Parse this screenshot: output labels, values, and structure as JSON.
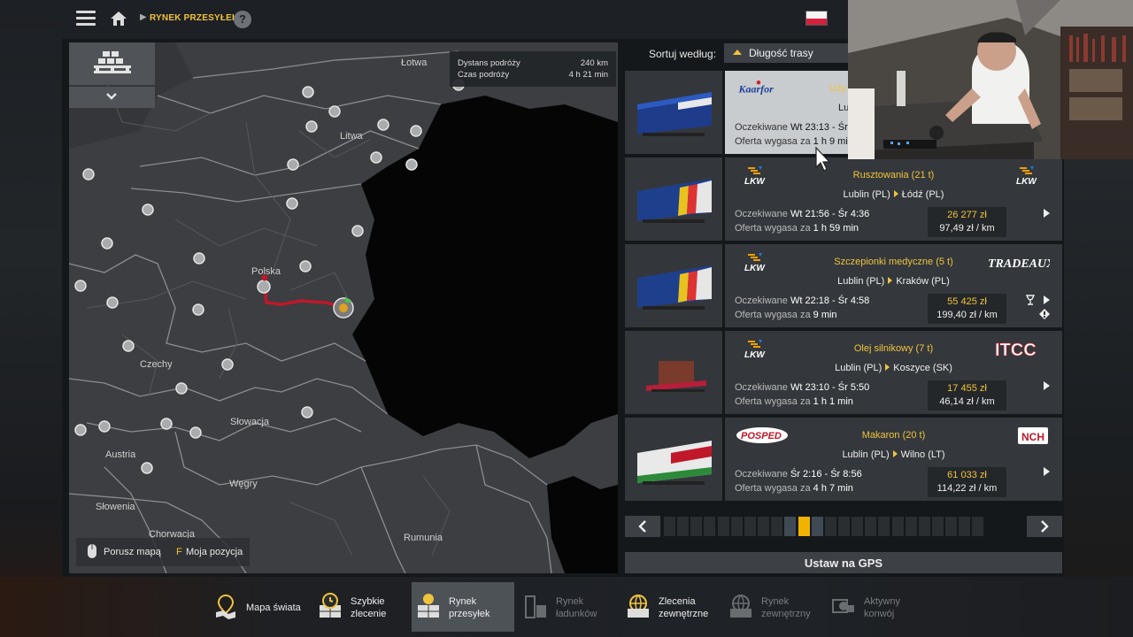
{
  "header": {
    "breadcrumb": "RYNEK PRZESYŁEK",
    "help_label": "?"
  },
  "map": {
    "info": {
      "distance_label": "Dystans podróży",
      "distance_value": "240 km",
      "time_label": "Czas podróży",
      "time_value": "4 h 21 min"
    },
    "labels": {
      "lotwa": "Łotwa",
      "litwa": "Litwa",
      "polska": "Polska",
      "czechy": "Czechy",
      "slowacja": "Słowacja",
      "austria": "Austria",
      "wegry": "Węgry",
      "slowenia": "Słowenia",
      "chorwacja": "Chorwacja",
      "rumunia": "Rumunia"
    },
    "help": {
      "mouse_label": "Porusz mapą",
      "key": "F",
      "key_label": "Moja pozycja"
    }
  },
  "sort": {
    "label": "Sortuj według:",
    "value": "Długość trasy"
  },
  "jobs": [
    {
      "cargo": "Uży",
      "route_from": "Lub",
      "route_to": "",
      "expected_label": "Oczekiwane",
      "expected": "Wt 23:13 - Śr",
      "offer_label": "Oferta wygasa za",
      "offer": "1 h 9 min",
      "price": "",
      "per_km": "",
      "logo_left": "Kaarfor",
      "logo_right": ""
    },
    {
      "cargo": "Rusztowania (21 t)",
      "route_from": "Lublin (PL)",
      "route_to": "Łódź (PL)",
      "expected_label": "Oczekiwane",
      "expected": "Wt 21:56 - Śr 4:36",
      "offer_label": "Oferta wygasa za",
      "offer": "1 h 59 min",
      "price": "26 277 zł",
      "per_km": "97,49 zł / km",
      "logo_left": "LKW",
      "logo_right": "LKW"
    },
    {
      "cargo": "Szczepionki medyczne (5 t)",
      "route_from": "Lublin (PL)",
      "route_to": "Kraków (PL)",
      "expected_label": "Oczekiwane",
      "expected": "Wt 22:18 - Śr 4:58",
      "offer_label": "Oferta wygasa za",
      "offer": "9 min",
      "price": "55 425 zł",
      "per_km": "199,40 zł / km",
      "logo_left": "LKW",
      "logo_right": "TRADEAUX"
    },
    {
      "cargo": "Olej silnikowy (7 t)",
      "route_from": "Lublin (PL)",
      "route_to": "Koszyce (SK)",
      "expected_label": "Oczekiwane",
      "expected": "Wt 23:10 - Śr 5:50",
      "offer_label": "Oferta wygasa za",
      "offer": "1 h 1 min",
      "price": "17 455 zł",
      "per_km": "46,14 zł / km",
      "logo_left": "LKW",
      "logo_right": "ITCC"
    },
    {
      "cargo": "Makaron (20 t)",
      "route_from": "Lublin (PL)",
      "route_to": "Wilno (LT)",
      "expected_label": "Oczekiwane",
      "expected": "Śr 2:16 - Śr 8:56",
      "offer_label": "Oferta wygasa za",
      "offer": "4 h 7 min",
      "price": "61 033 zł",
      "per_km": "114,22 zł / km",
      "logo_left": "POSPED",
      "logo_right": "NCH"
    }
  ],
  "pager": {
    "total_pages": 24,
    "current_page": 11
  },
  "gps_button": "Ustaw na GPS",
  "nav": [
    {
      "l1": "Mapa świata",
      "l2": ""
    },
    {
      "l1": "Szybkie",
      "l2": "zlecenie"
    },
    {
      "l1": "Rynek",
      "l2": "przesyłek"
    },
    {
      "l1": "Rynek",
      "l2": "ładunków"
    },
    {
      "l1": "Zlecenia",
      "l2": "zewnętrzne"
    },
    {
      "l1": "Rynek",
      "l2": "zewnętrzny"
    },
    {
      "l1": "Aktywny",
      "l2": "konwój"
    }
  ],
  "colors": {
    "accent": "#f0c33c",
    "route": "#c0182a",
    "panel": "#34383c",
    "selected": "#c9cccf"
  }
}
